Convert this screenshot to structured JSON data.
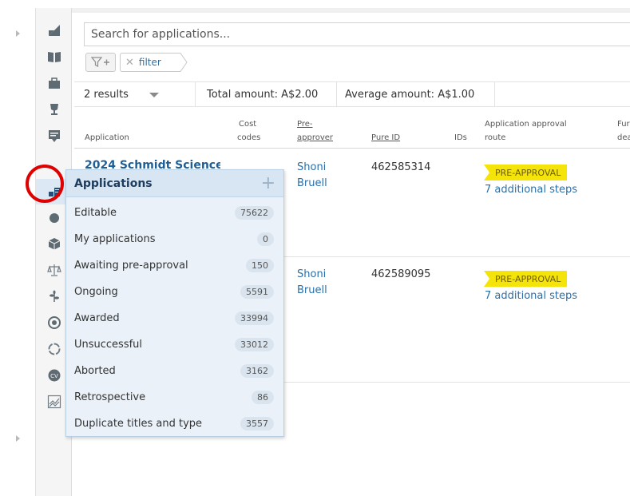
{
  "rail": {
    "items": [
      {
        "icon": "dashboard-icon"
      },
      {
        "icon": "book-icon"
      },
      {
        "icon": "briefcase-icon"
      },
      {
        "icon": "trophy-icon"
      },
      {
        "icon": "presentation-icon"
      },
      {
        "icon": "coins-icon",
        "active": true
      },
      {
        "icon": "apple-icon"
      },
      {
        "icon": "cube-icon"
      },
      {
        "icon": "scales-icon"
      },
      {
        "icon": "plant-icon"
      },
      {
        "icon": "target-icon"
      },
      {
        "icon": "ring-icon"
      },
      {
        "icon": "cv-icon"
      },
      {
        "icon": "chart-icon"
      }
    ]
  },
  "search": {
    "placeholder": "Search for applications..."
  },
  "filter": {
    "chip_label": "filter"
  },
  "results": {
    "count": "2 results",
    "total": "Total amount: A$2.00",
    "average": "Average amount: A$1.00"
  },
  "table": {
    "headers": {
      "application": "Application",
      "cost_codes_1": "Cost",
      "cost_codes_2": "codes",
      "pre_approver_1": "Pre-",
      "pre_approver_2": "approver",
      "pure_id": "Pure ID",
      "ids": "IDs",
      "approval_route_1": "Application approval",
      "approval_route_2": "route",
      "fu_1": "Fur",
      "fu_2": "dea"
    },
    "rows": [
      {
        "title": "2024 Schmidt Science",
        "pre_approver_first": "Shoni",
        "pre_approver_last": "Bruell",
        "pure_id": "462585314",
        "badge": "PRE-APPROVAL",
        "steps": "7 additional steps"
      },
      {
        "title": "",
        "pre_approver_first": "Shoni",
        "pre_approver_last": "Bruell",
        "pure_id": "462589095",
        "badge": "PRE-APPROVAL",
        "steps": "7 additional steps"
      }
    ]
  },
  "popup": {
    "title": "Applications",
    "items": [
      {
        "label": "Editable",
        "count": "75622"
      },
      {
        "label": "My applications",
        "count": "0"
      },
      {
        "label": "Awaiting pre-approval",
        "count": "150"
      },
      {
        "label": "Ongoing",
        "count": "5591"
      },
      {
        "label": "Awarded",
        "count": "33994"
      },
      {
        "label": "Unsuccessful",
        "count": "33012"
      },
      {
        "label": "Aborted",
        "count": "3162"
      },
      {
        "label": "Retrospective",
        "count": "86"
      },
      {
        "label": "Duplicate titles and type",
        "count": "3557"
      }
    ]
  },
  "colors": {
    "accent": "#2b6fa8",
    "badge": "#f5e40a",
    "highlight": "#e00000"
  }
}
